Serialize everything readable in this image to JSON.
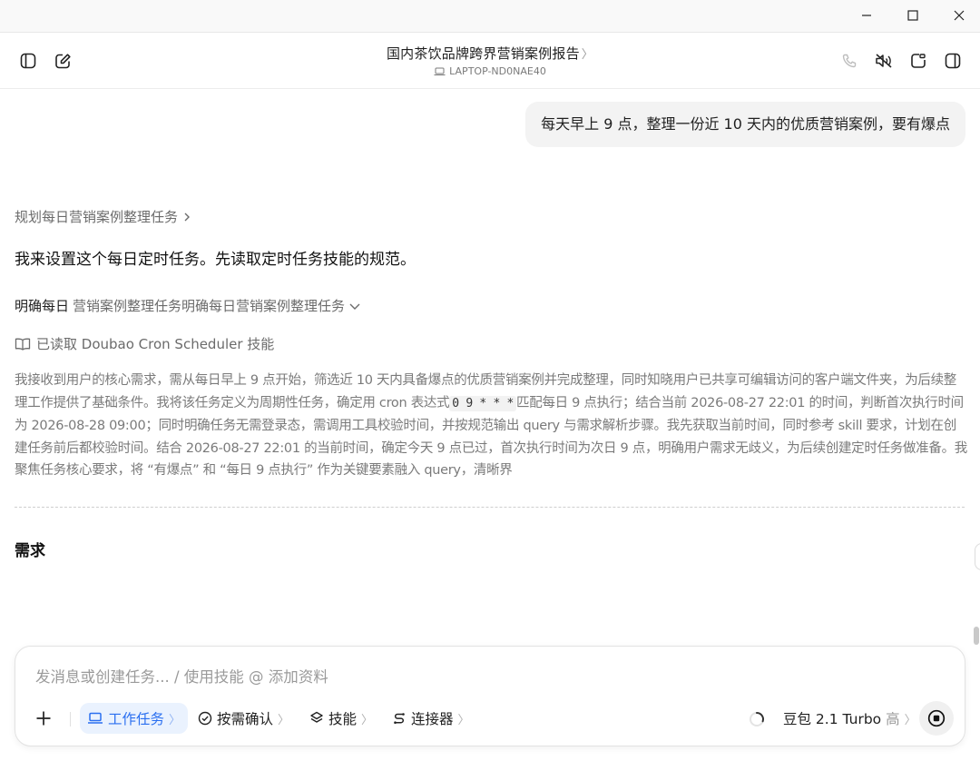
{
  "window": {
    "controls": [
      "minimize-icon",
      "maximize-icon",
      "close-icon"
    ]
  },
  "header": {
    "title": "国内茶饮品牌跨界营销案例报告",
    "title_chevron": "〉",
    "device": "LAPTOP-ND0NAE40",
    "left_icons": [
      "sidebar-toggle-icon",
      "new-chat-icon"
    ],
    "right_icons": [
      "phone-icon",
      "mute-icon",
      "new-window-icon",
      "panel-icon"
    ]
  },
  "conversation": {
    "user_message": "每天早上 9 点，整理一份近 10 天内的优质营销案例，要有爆点",
    "step_title": "规划每日营销案例整理任务",
    "assistant_message": "我来设置这个每日定时任务。先读取定时任务技能的规范。",
    "plan_dark": "明确每日",
    "plan_rest": "营销案例整理任务明确每日营销案例整理任务",
    "read_skill": "已读取 Doubao Cron Scheduler 技能",
    "reasoning_before_code": "我接收到用户的核心需求，需从每日早上 9 点开始，筛选近 10 天内具备爆点的优质营销案例并完成整理，同时知晓用户已共享可编辑访问的客户端文件夹，为后续整理工作提供了基础条件。我将该任务定义为周期性任务，确定用 cron 表达式",
    "reasoning_code": "0 9 * * *",
    "reasoning_after_code": "匹配每日 9 点执行；结合当前 2026-08-27 22:01 的时间，判断首次执行时间为 2026-08-28 09:00；同时明确任务无需登录态，需调用工具校验时间，并按规范输出 query 与需求解析步骤。我先获取当前时间，同时参考 skill 要求，计划在创建任务前后都校验时间。结合 2026-08-27 22:01 的当前时间，确定今天 9 点已过，首次执行时间为次日 9 点，明确用户需求无歧义，为后续创建定时任务做准备。我聚焦任务核心要求，将 “有爆点” 和 “每日 9 点执行” 作为关键要素融入 query，清晰界",
    "section_heading": "需求"
  },
  "composer": {
    "placeholder": "发消息或创建任务... / 使用技能 @ 添加资料",
    "chips": [
      {
        "label": "工作任务",
        "icon": "laptop-icon",
        "active": true
      },
      {
        "label": "按需确认",
        "icon": "check-shield-icon",
        "active": false
      },
      {
        "label": "技能",
        "icon": "layers-icon",
        "active": false
      },
      {
        "label": "连接器",
        "icon": "connector-icon",
        "active": false
      }
    ],
    "chip_arrow": "〉",
    "model": "豆包 2.1 Turbo",
    "model_level": "高",
    "colors": {
      "accent": "#2a6ff0",
      "accent_bg": "#eaf2fe"
    }
  }
}
